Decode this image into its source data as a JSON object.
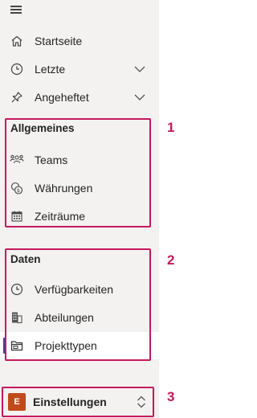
{
  "nav": {
    "top_items": [
      {
        "label": "Startseite",
        "icon": "home-icon"
      },
      {
        "label": "Letzte",
        "icon": "clock-icon",
        "expandable": true
      },
      {
        "label": "Angeheftet",
        "icon": "pin-icon",
        "expandable": true
      }
    ],
    "group1": {
      "title": "Allgemeines",
      "items": [
        {
          "label": "Teams",
          "icon": "people-team-icon"
        },
        {
          "label": "Währungen",
          "icon": "currency-icon"
        },
        {
          "label": "Zeiträume",
          "icon": "calendar-icon"
        }
      ]
    },
    "group2": {
      "title": "Daten",
      "items": [
        {
          "label": "Verfügbarkeiten",
          "icon": "clock-icon"
        },
        {
          "label": "Abteilungen",
          "icon": "building-icon"
        },
        {
          "label": "Projekttypen",
          "icon": "folder-icon",
          "selected": true
        }
      ]
    },
    "settings": {
      "avatar_letter": "E",
      "label": "Einstellungen",
      "icon": "chevron-up-down-icon"
    }
  },
  "annotations": {
    "marker1": "1",
    "marker2": "2",
    "marker3": "3"
  },
  "colors": {
    "highlight_border": "#c6195e",
    "avatar_bg": "#c14a1b",
    "selection_bar": "#4f3a8f",
    "nav_bg": "#f3f2f1"
  }
}
